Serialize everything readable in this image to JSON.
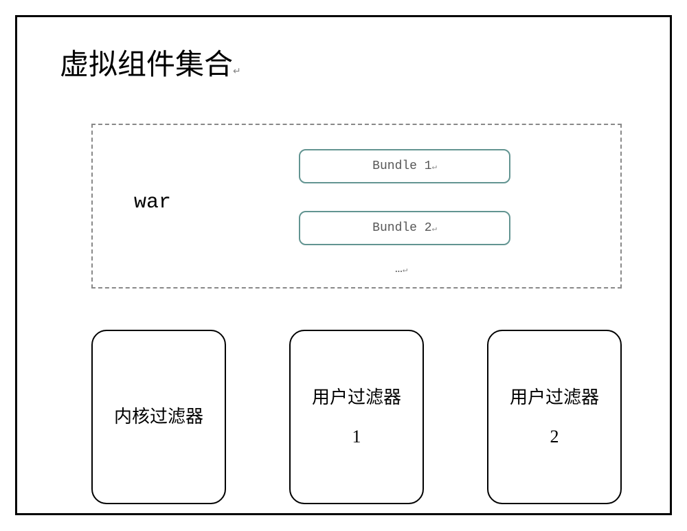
{
  "title": "虚拟组件集合",
  "titleMark": "↵",
  "war": {
    "label": "war",
    "bundles": [
      {
        "label": "Bundle 1",
        "mark": "↵"
      },
      {
        "label": "Bundle 2",
        "mark": "↵"
      }
    ],
    "ellipsis": "…",
    "ellipsisMark": "↵"
  },
  "filters": [
    {
      "label": "内核过滤器",
      "number": ""
    },
    {
      "label": "用户过滤器",
      "number": "1"
    },
    {
      "label": "用户过滤器",
      "number": "2"
    }
  ]
}
